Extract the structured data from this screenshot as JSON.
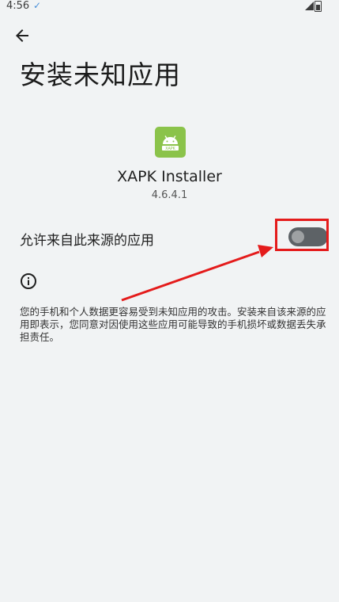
{
  "status_bar": {
    "time": "4:56",
    "check_glyph": "✓"
  },
  "page": {
    "title": "安装未知应用"
  },
  "app": {
    "name": "XAPK Installer",
    "version": "4.6.4.1",
    "icon_text": "XAPK",
    "icon_color": "#8bc34a"
  },
  "setting": {
    "label": "允许来自此来源的应用",
    "enabled": false
  },
  "notice": {
    "text": "您的手机和个人数据更容易受到未知应用的攻击。安装来自该来源的应用即表示，您同意对因使用这些应用可能导致的手机损坏或数据丢失承担责任。"
  },
  "colors": {
    "background": "#f1f3f4",
    "toggle_track": "#5d6266",
    "annotation": "#e41b1b"
  }
}
